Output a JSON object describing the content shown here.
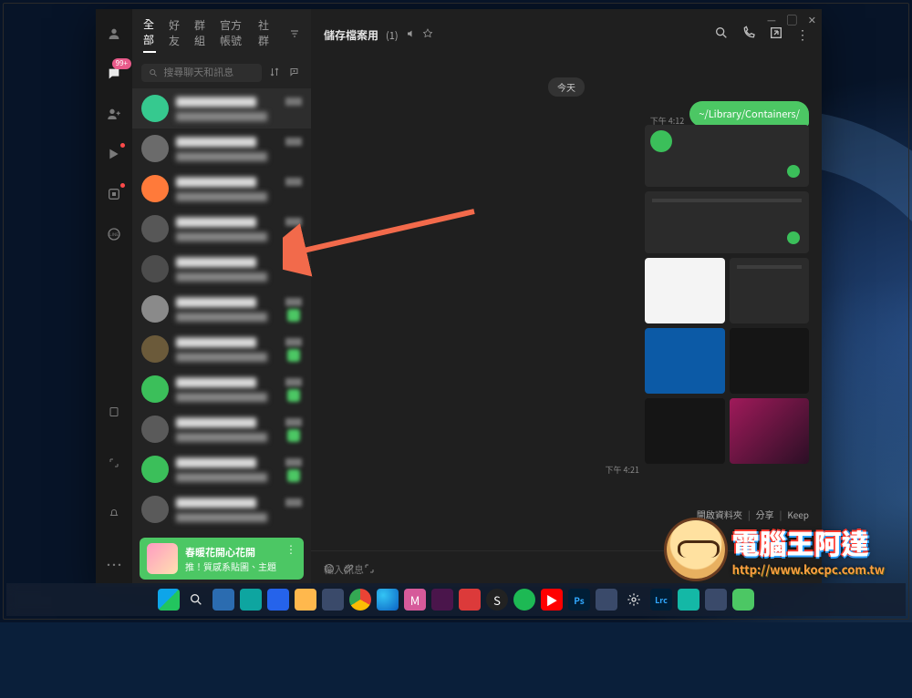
{
  "sidebar_badge": "99+",
  "tabs": {
    "items": [
      "全部",
      "好友",
      "群組",
      "官方帳號",
      "社群"
    ],
    "active_index": 0
  },
  "search": {
    "placeholder": "搜尋聊天和訊息"
  },
  "chat_list": [
    {
      "avatar_color": "#36c98f",
      "has_unread": false,
      "selected": true
    },
    {
      "avatar_color": "#6b6b6b",
      "has_unread": false
    },
    {
      "avatar_color": "#ff7a3a",
      "has_unread": false
    },
    {
      "avatar_color": "#575757",
      "has_unread": false
    },
    {
      "avatar_color": "#4c4c4c",
      "has_unread": false
    },
    {
      "avatar_color": "#8a8a8a",
      "has_unread": true
    },
    {
      "avatar_color": "#6b5a3a",
      "has_unread": true
    },
    {
      "avatar_color": "#3bbf5a",
      "has_unread": true
    },
    {
      "avatar_color": "#5a5a5a",
      "has_unread": true
    },
    {
      "avatar_color": "#3bbf5a",
      "has_unread": true
    },
    {
      "avatar_color": "#5a5a5a",
      "has_unread": false
    },
    {
      "avatar_color": "#3bbf5a",
      "has_unread": false
    }
  ],
  "promo": {
    "title": "春暖花開心花開",
    "subtitle": "推！質感系貼圖、主題"
  },
  "chat_view": {
    "title": "儲存檔案用",
    "member_count": "(1)",
    "date_label": "今天",
    "bubble_text": "~/Library/Containers/",
    "time1": "下午 4:12",
    "time2": "下午 4:21",
    "footer_links": [
      "開啟資料夾",
      "分享",
      "Keep"
    ],
    "input_placeholder": "輸入訊息"
  },
  "watermark": {
    "main_text": "電腦王阿達",
    "sub_text": "http://www.kocpc.com.tw"
  },
  "taskbar": {
    "icon_count": 22
  }
}
